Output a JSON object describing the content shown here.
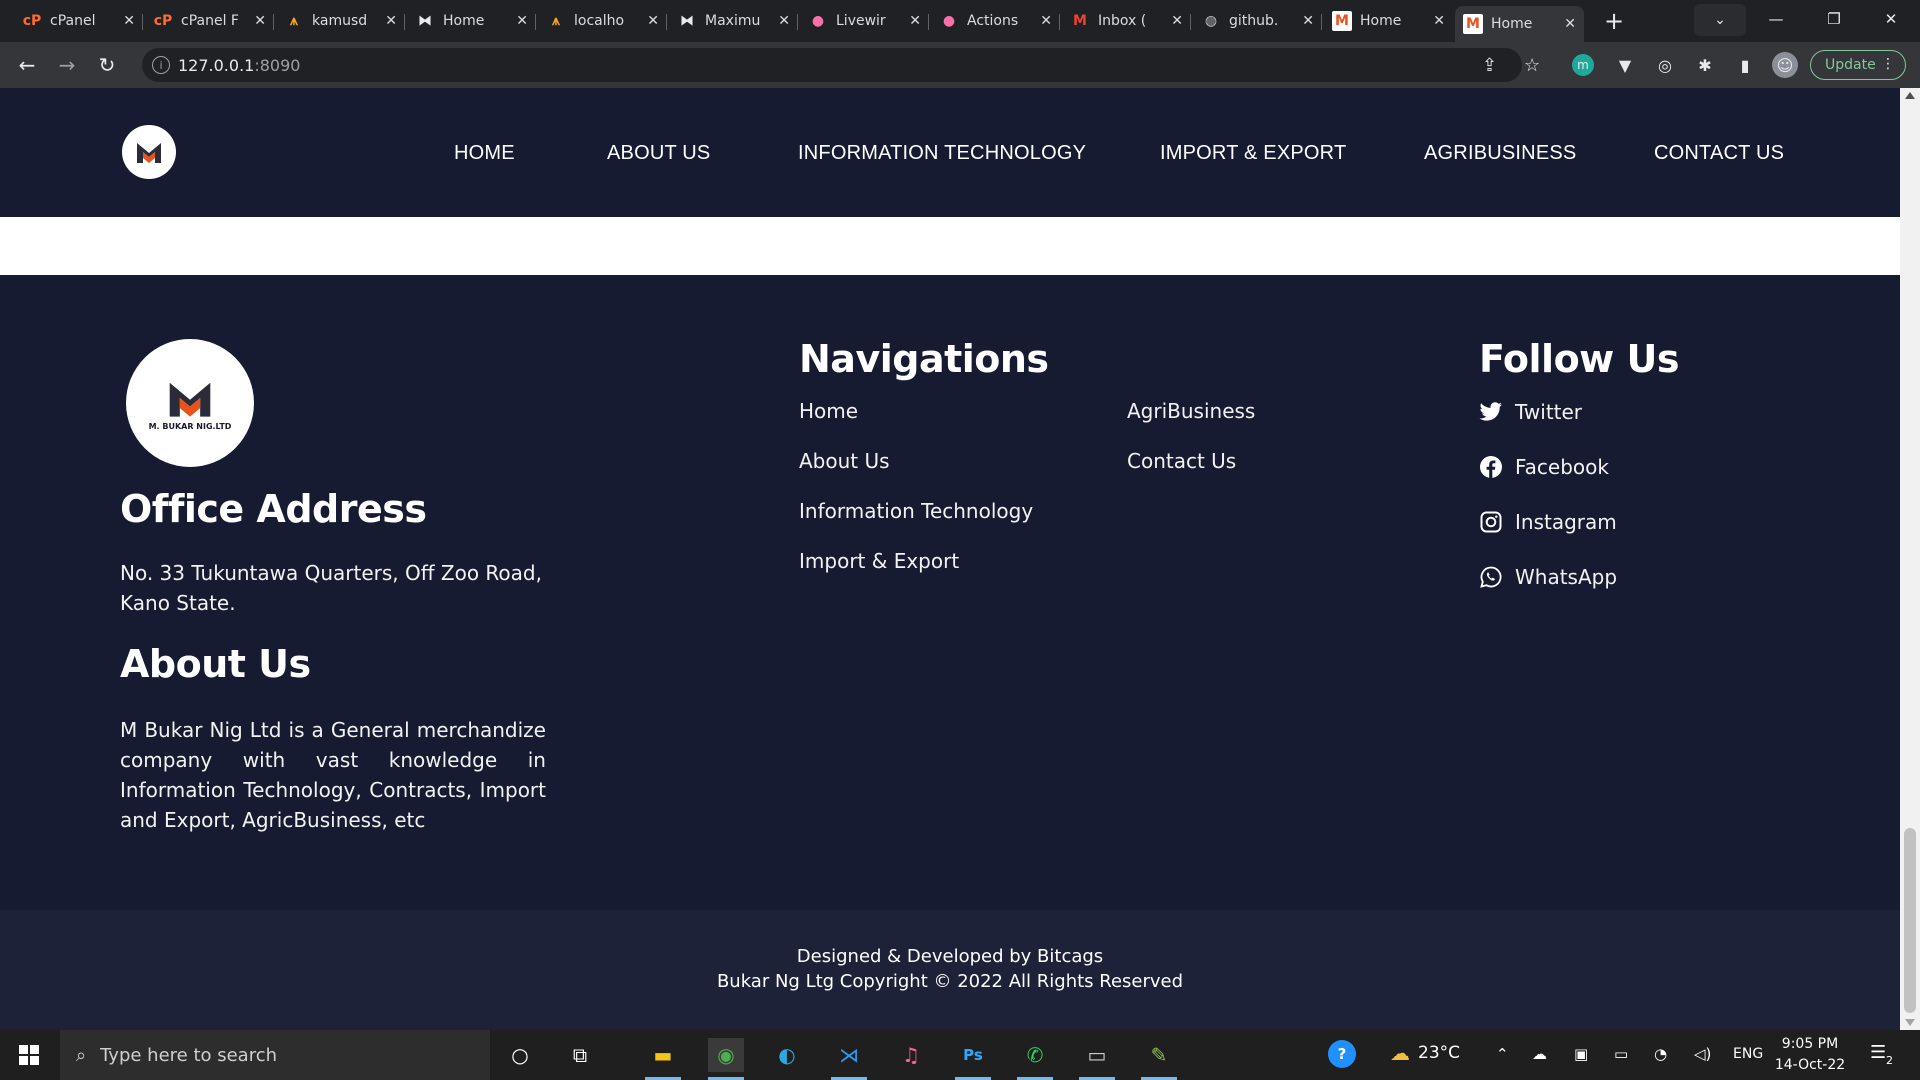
{
  "browser": {
    "tabs": [
      {
        "title": "cPanel",
        "icon": "cpanel-icon"
      },
      {
        "title": "cPanel F",
        "icon": "cpanel-icon"
      },
      {
        "title": "kamusd",
        "icon": "codeigniter-icon"
      },
      {
        "title": "Home",
        "icon": "laravel-icon"
      },
      {
        "title": "localho",
        "icon": "codeigniter-icon"
      },
      {
        "title": "Maximu",
        "icon": "laravel-icon"
      },
      {
        "title": "Livewir",
        "icon": "livewire-icon"
      },
      {
        "title": "Actions",
        "icon": "livewire-icon"
      },
      {
        "title": "Inbox (",
        "icon": "gmail-icon"
      },
      {
        "title": "github.",
        "icon": "globe-icon"
      },
      {
        "title": "Home",
        "icon": "site-m-icon"
      },
      {
        "title": "Home",
        "icon": "site-m-icon",
        "active": true
      }
    ],
    "url_host": "127.0.0.1",
    "url_port": ":8090",
    "update_label": "Update"
  },
  "site": {
    "nav": [
      "HOME",
      "ABOUT US",
      "INFORMATION TECHNOLOGY",
      "IMPORT & EXPORT",
      "AGRIBUSINESS",
      "CONTACT US"
    ],
    "footer": {
      "logo_text": "M. BUKAR NIG.LTD",
      "office_heading": "Office Address",
      "office_address": "No. 33 Tukuntawa Quarters, Off Zoo Road, Kano State.",
      "about_heading": "About Us",
      "about_text": "M Bukar Nig Ltd is a General merchandize company with vast knowledge in Information Technology, Contracts, Import and Export, AgricBusiness, etc",
      "nav_heading": "Navigations",
      "nav_col1": [
        "Home",
        "About Us",
        "Information Technology",
        "Import & Export"
      ],
      "nav_col2": [
        "AgriBusiness",
        "Contact Us"
      ],
      "follow_heading": "Follow Us",
      "social": [
        {
          "label": "Twitter",
          "icon": "twitter-icon"
        },
        {
          "label": "Facebook",
          "icon": "facebook-icon"
        },
        {
          "label": "Instagram",
          "icon": "instagram-icon"
        },
        {
          "label": "WhatsApp",
          "icon": "whatsapp-icon"
        }
      ],
      "credit": "Designed & Developed by Bitcags",
      "copyright": "Bukar Ng Ltg Copyright © 2022 All Rights Reserved"
    }
  },
  "taskbar": {
    "search_placeholder": "Type here to search",
    "weather": "23°C",
    "language": "ENG",
    "time": "9:05 PM",
    "date": "14-Oct-22",
    "notification_count": "2"
  },
  "colors": {
    "page_bg": "#171b31",
    "copyright_bg": "#1d2239",
    "accent_orange": "#e8531c"
  }
}
